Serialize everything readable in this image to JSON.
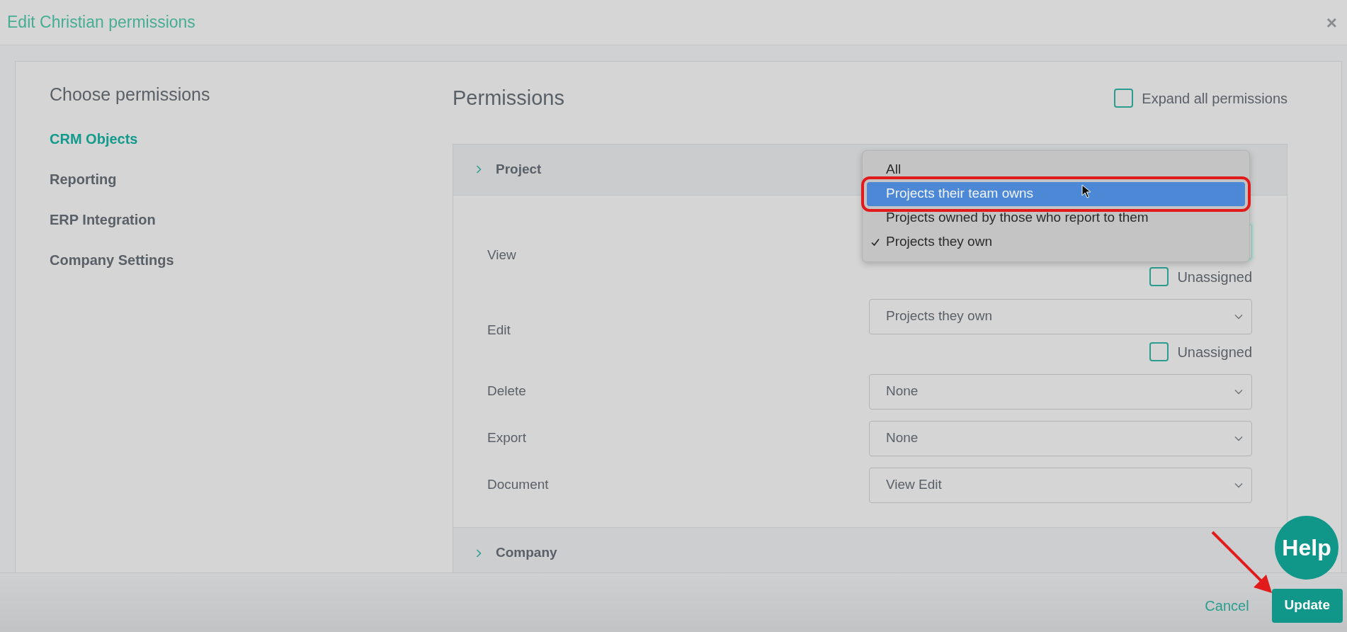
{
  "dialog": {
    "title": "Edit Christian permissions",
    "close": "×"
  },
  "sidebar": {
    "heading": "Choose permissions",
    "items": [
      {
        "label": "CRM Objects",
        "selected": true
      },
      {
        "label": "Reporting",
        "selected": false
      },
      {
        "label": "ERP Integration",
        "selected": false
      },
      {
        "label": "Company Settings",
        "selected": false
      }
    ]
  },
  "permissions": {
    "heading": "Permissions",
    "expand_all": {
      "label": "Expand all permissions",
      "checked": false
    },
    "sections": [
      {
        "title": "Project",
        "expanded": true,
        "rows": [
          {
            "label": "View",
            "focused": true,
            "dropdown": {
              "options": [
                {
                  "label": "All",
                  "highlighted": false,
                  "checked": false
                },
                {
                  "label": "Projects their team owns",
                  "highlighted": true,
                  "checked": false
                },
                {
                  "label": "Projects owned by those who report to them",
                  "highlighted": false,
                  "checked": false
                },
                {
                  "label": "Projects they own",
                  "highlighted": false,
                  "checked": true
                }
              ]
            },
            "unassigned": {
              "label": "Unassigned",
              "checked": false
            }
          },
          {
            "label": "Edit",
            "focused": false,
            "value": "Projects they own",
            "unassigned": {
              "label": "Unassigned",
              "checked": false
            }
          },
          {
            "label": "Delete",
            "focused": false,
            "value": "None"
          },
          {
            "label": "Export",
            "focused": false,
            "value": "None"
          },
          {
            "label": "Document",
            "focused": false,
            "value": "View Edit"
          }
        ]
      },
      {
        "title": "Company",
        "expanded": false
      }
    ]
  },
  "help_button": "Help",
  "footer": {
    "cancel": "Cancel",
    "update": "Update"
  }
}
